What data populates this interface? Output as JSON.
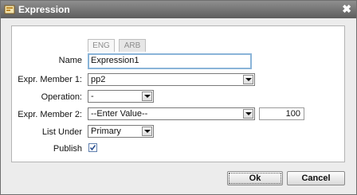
{
  "window": {
    "title": "Expression"
  },
  "lang_tabs": [
    "ENG",
    "ARB"
  ],
  "form": {
    "name_label": "Name",
    "name_value": "Expression1",
    "member1_label": "Expr. Member 1:",
    "member1_value": "pp2",
    "operation_label": "Operation:",
    "operation_value": "-",
    "member2_label": "Expr. Member 2:",
    "member2_value": "--Enter Value--",
    "member2_number": "100",
    "listunder_label": "List Under",
    "listunder_value": "Primary",
    "publish_label": "Publish",
    "publish_checked": true
  },
  "buttons": {
    "ok": "Ok",
    "cancel": "Cancel"
  }
}
